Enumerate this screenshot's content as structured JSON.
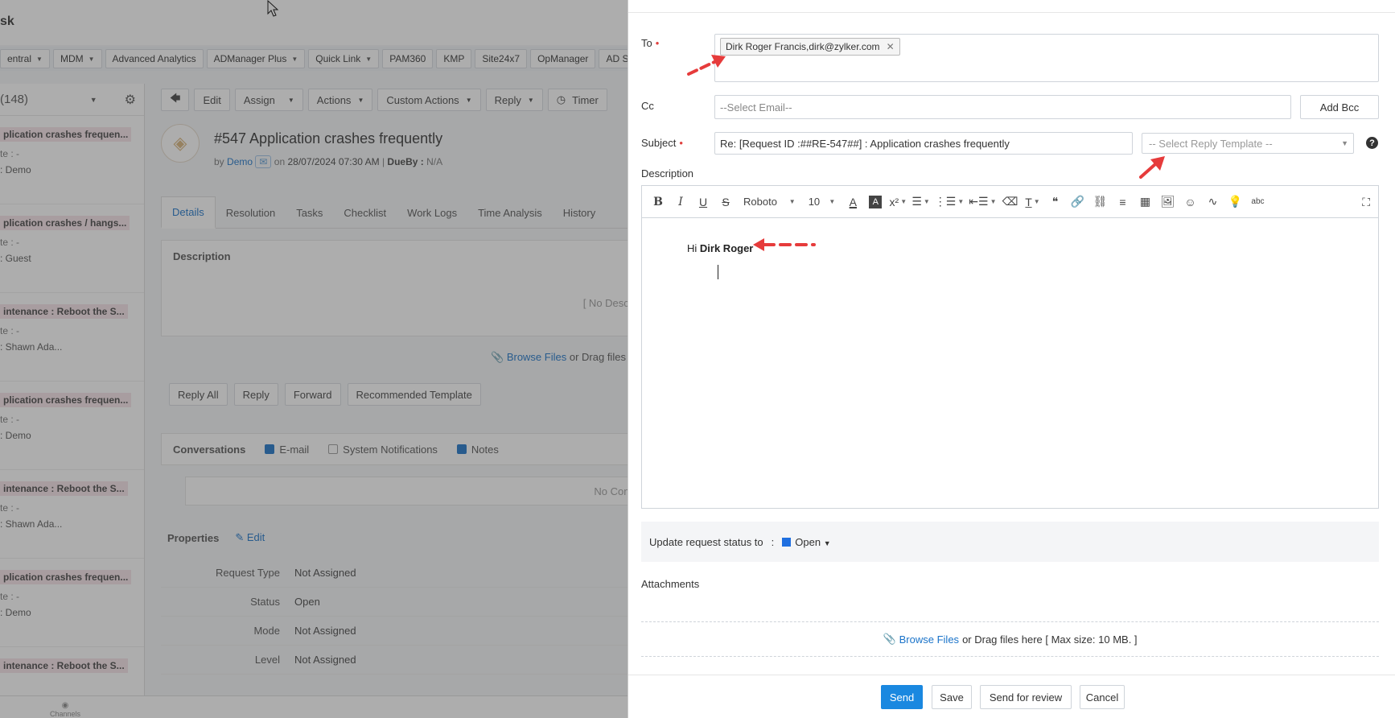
{
  "background": {
    "app_title": "sk",
    "quick_links": [
      {
        "label": "entral",
        "has_dropdown": true
      },
      {
        "label": "MDM",
        "has_dropdown": true
      },
      {
        "label": "Advanced Analytics",
        "has_dropdown": false
      },
      {
        "label": "ADManager Plus",
        "has_dropdown": true
      },
      {
        "label": "Quick Link",
        "has_dropdown": true
      },
      {
        "label": "PAM360",
        "has_dropdown": false
      },
      {
        "label": "KMP",
        "has_dropdown": false
      },
      {
        "label": "Site24x7",
        "has_dropdown": false
      },
      {
        "label": "OpManager",
        "has_dropdown": false
      },
      {
        "label": "AD Self",
        "has_dropdown": false
      }
    ],
    "list_header": "(148)",
    "list_items": [
      {
        "title": "plication crashes frequen...",
        "sub": "te : -",
        "owner": ": Demo"
      },
      {
        "title": "plication crashes / hangs...",
        "sub": "te : -",
        "owner": ": Guest"
      },
      {
        "title": "intenance : Reboot the S...",
        "sub": "te : -",
        "owner": ": Shawn Ada..."
      },
      {
        "title": "plication crashes frequen...",
        "sub": "te : -",
        "owner": ": Demo"
      },
      {
        "title": "intenance : Reboot the S...",
        "sub": "te : -",
        "owner": ": Shawn Ada..."
      },
      {
        "title": "plication crashes frequen...",
        "sub": "te : -",
        "owner": ": Demo"
      },
      {
        "title": "intenance : Reboot the S...",
        "sub": "",
        "owner": ""
      }
    ],
    "toolbar": [
      "Edit",
      "Assign",
      "Actions",
      "Custom Actions",
      "Reply",
      "Timer"
    ],
    "request": {
      "title": "#547  Application crashes frequently",
      "by_label": "by",
      "author": "Demo",
      "on_label": "on",
      "date": "28/07/2024 07:30 AM",
      "dueby_label": "DueBy :",
      "dueby_value": "N/A"
    },
    "tabs": [
      "Details",
      "Resolution",
      "Tasks",
      "Checklist",
      "Work Logs",
      "Time Analysis",
      "History"
    ],
    "description_heading": "Description",
    "no_description": "[ No Descri",
    "browse_link": "Browse Files",
    "browse_rest": "or Drag files",
    "reply_buttons": [
      "Reply All",
      "Reply",
      "Forward",
      "Recommended Template"
    ],
    "conversations_label": "Conversations",
    "conv_filters": [
      {
        "label": "E-mail",
        "checked": true
      },
      {
        "label": "System Notifications",
        "checked": false
      },
      {
        "label": "Notes",
        "checked": true
      }
    ],
    "no_conversations": "No Conv",
    "properties_label": "Properties",
    "properties_edit": "Edit",
    "properties": [
      {
        "key": "Request Type",
        "value": "Not Assigned"
      },
      {
        "key": "Status",
        "value": "Open"
      },
      {
        "key": "Mode",
        "value": "Not Assigned"
      },
      {
        "key": "Level",
        "value": "Not Assigned"
      }
    ],
    "channels_label": "Channels"
  },
  "dialog": {
    "to_label": "To",
    "to_chip": "Dirk Roger Francis,dirk@zylker.com",
    "cc_label": "Cc",
    "cc_placeholder": "--Select Email--",
    "add_bcc": "Add Bcc",
    "subject_label": "Subject",
    "subject_value": "Re: [Request ID :##RE-547##] : Application crashes frequently",
    "reply_template_placeholder": "-- Select Reply Template --",
    "description_label": "Description",
    "editor": {
      "font": "Roboto",
      "font_size": "10",
      "greeting_prefix": "Hi",
      "greeting_name": "Dirk Roger"
    },
    "status_label": "Update request status to",
    "status_sep": ":",
    "status_value": "Open",
    "status_color": "#1f6fe0",
    "attachments_label": "Attachments",
    "attach_link": "Browse Files",
    "attach_rest": "or Drag files here [ Max size: 10 MB. ]",
    "buttons": {
      "send": "Send",
      "save": "Save",
      "send_for_review": "Send for review",
      "cancel": "Cancel"
    }
  },
  "colors": {
    "accent": "#1a88e0",
    "link": "#1a73c9",
    "annotation_arrow": "#e63b3b"
  }
}
